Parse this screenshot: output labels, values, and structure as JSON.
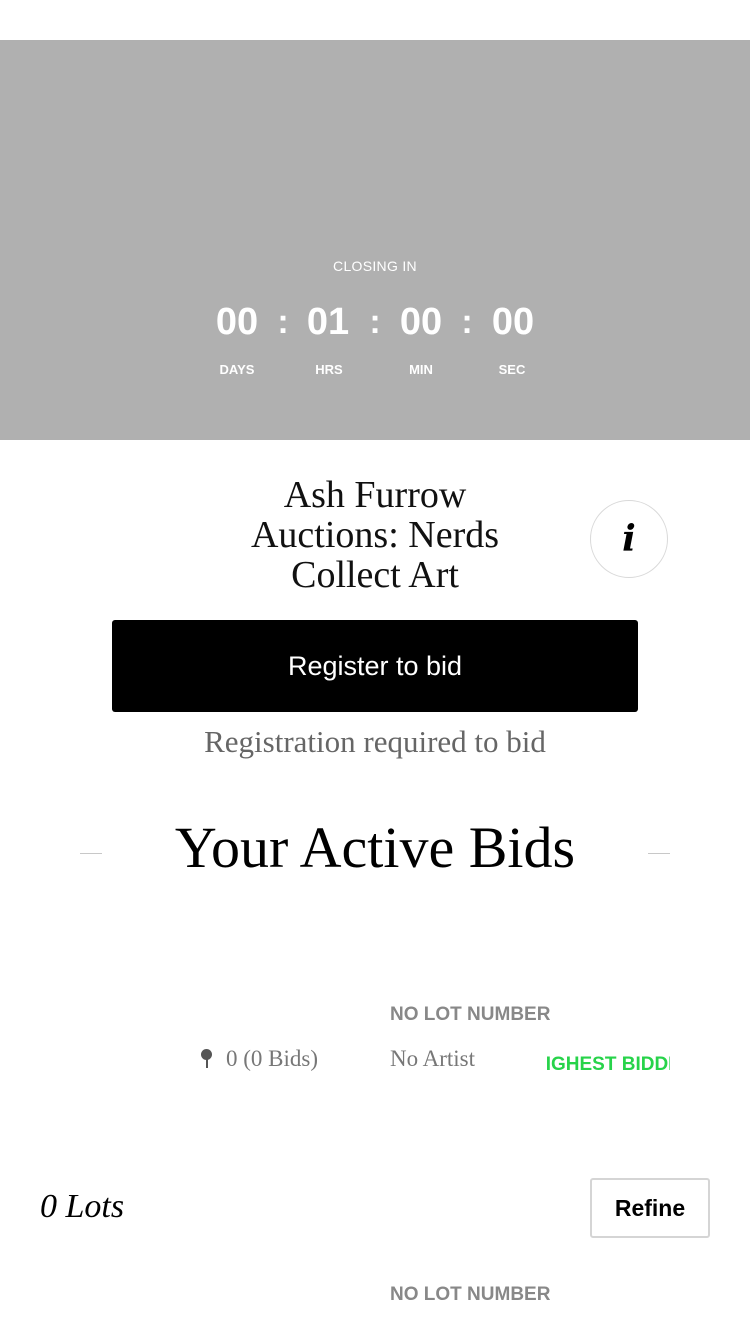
{
  "auction": {
    "closing_label": "CLOSING IN",
    "countdown": [
      {
        "value": "00",
        "unit": "DAYS"
      },
      {
        "value": "01",
        "unit": "HRS"
      },
      {
        "value": "00",
        "unit": "MIN"
      },
      {
        "value": "00",
        "unit": "SEC"
      }
    ],
    "separator": ":",
    "title_lines": [
      "Ash Furrow",
      "Auctions: Nerds",
      "Collect Art"
    ],
    "info_icon_glyph": "i",
    "register_label": "Register to bid",
    "registration_note": "Registration required to bid"
  },
  "active_bids": {
    "heading": "Your Active Bids",
    "item": {
      "lot_number": "NO LOT NUMBER",
      "bid_summary": "0 (0 Bids)",
      "artist": "No Artist",
      "status": "HIGHEST BIDDER",
      "status_color": "#27d34a"
    }
  },
  "lots": {
    "count_label": "0 Lots",
    "refine_label": "Refine",
    "first_lot_number": "NO LOT NUMBER"
  },
  "icons": {
    "info": "info-icon",
    "gavel": "gavel-icon"
  }
}
